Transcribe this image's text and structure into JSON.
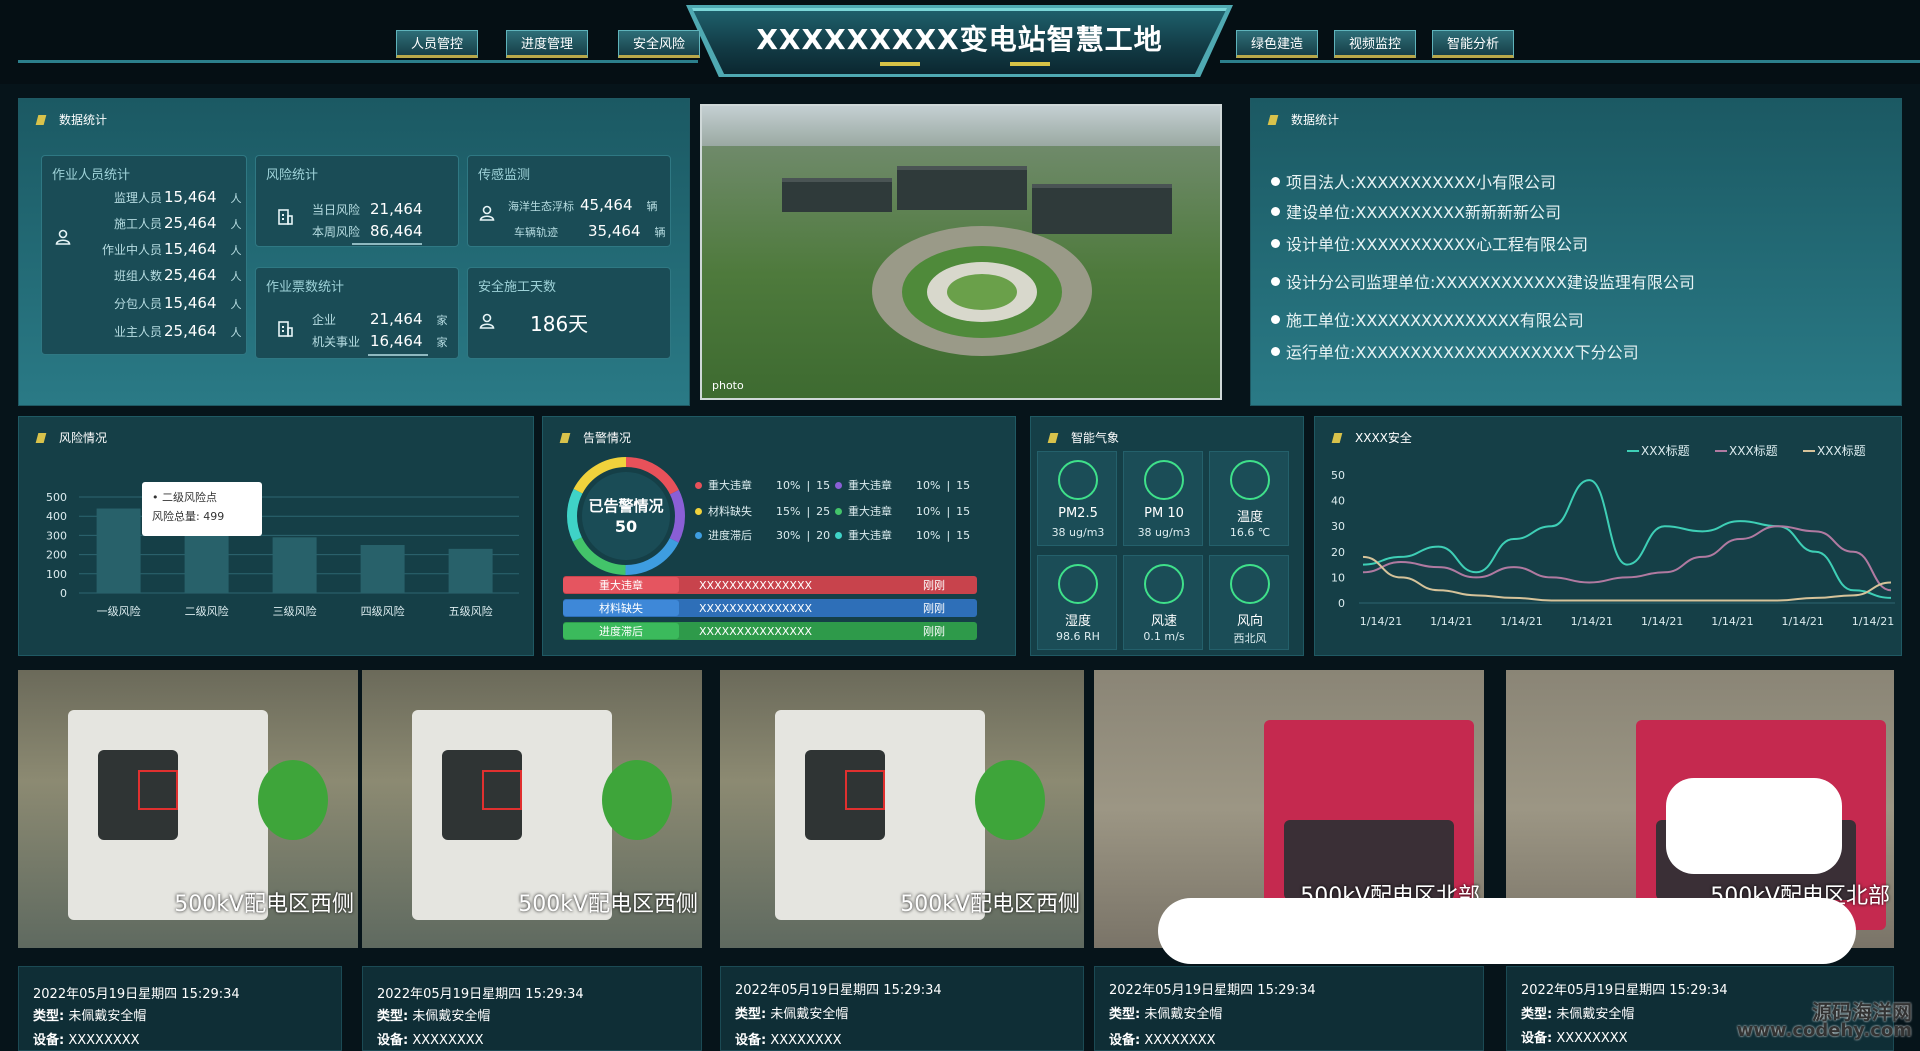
{
  "header": {
    "title": "XXXXXXXXX变电站智慧工地",
    "nav_left": [
      "人员管控",
      "进度管理",
      "安全风险"
    ],
    "nav_right": [
      "绿色建造",
      "视频监控",
      "智能分析"
    ]
  },
  "stats": {
    "title": "数据统计",
    "workers": {
      "title": "作业人员统计",
      "rows": [
        {
          "label": "监理人员",
          "value": "15,464",
          "unit": "人"
        },
        {
          "label": "施工人员",
          "value": "25,464",
          "unit": "人"
        },
        {
          "label": "作业中人员",
          "value": "15,464",
          "unit": "人"
        },
        {
          "label": "班组人数",
          "value": "25,464",
          "unit": "人"
        },
        {
          "label": "分包人员",
          "value": "15,464",
          "unit": "人"
        },
        {
          "label": "业主人员",
          "value": "25,464",
          "unit": "人"
        }
      ]
    },
    "risk": {
      "title": "风险统计",
      "rows": [
        {
          "label": "当日风险",
          "value": "21,464"
        },
        {
          "label": "本周风险",
          "value": "86,464"
        }
      ]
    },
    "sensor": {
      "title": "传感监测",
      "rows": [
        {
          "label": "海洋生态浮标",
          "value": "45,464",
          "unit": "辆"
        },
        {
          "label": "车辆轨迹",
          "value": "35,464",
          "unit": "辆"
        }
      ]
    },
    "tickets": {
      "title": "作业票数统计",
      "rows": [
        {
          "label": "企业",
          "value": "21,464",
          "unit": "家"
        },
        {
          "label": "机关事业",
          "value": "16,464",
          "unit": "家"
        }
      ]
    },
    "safe_days": {
      "title": "安全施工天数",
      "value": "186天"
    }
  },
  "site_image": {
    "watermark": "photo"
  },
  "info": {
    "title": "数据统计",
    "items": [
      "项目法人:XXXXXXXXXXX小有限公司",
      "建设单位:XXXXXXXXXX新新新新公司",
      "设计单位:XXXXXXXXXXX心工程有限公司",
      "设计分公司监理单位:XXXXXXXXXXXX建设监理有限公司",
      "施工单位:XXXXXXXXXXXXXXX有限公司",
      "运行单位:XXXXXXXXXXXXXXXXXXXX下分公司"
    ]
  },
  "risk_panel": {
    "title": "风险情况",
    "tooltip": {
      "name": "二级风险点",
      "label": "风险总量",
      "value": "499"
    }
  },
  "chart_data": [
    {
      "type": "bar",
      "categories": [
        "一级风险",
        "二级风险",
        "三级风险",
        "四级风险",
        "五级风险"
      ],
      "values": [
        440,
        499,
        290,
        250,
        230
      ],
      "ylim": [
        0,
        500
      ],
      "yticks": [
        "0",
        "100",
        "200",
        "300",
        "400",
        "500"
      ],
      "title": "",
      "xlabel": "",
      "ylabel": "",
      "grid": true
    },
    {
      "type": "line",
      "title": "",
      "x": [
        "1/14/21",
        "1/14/21",
        "1/14/21",
        "1/14/21",
        "1/14/21",
        "1/14/21",
        "1/14/21",
        "1/14/21"
      ],
      "ylim": [
        0,
        50
      ],
      "yticks": [
        "0",
        "10",
        "20",
        "30",
        "40",
        "50"
      ],
      "legend_placement": "top-right",
      "series": [
        {
          "name": "XXX标题",
          "color": "#3ecfb6",
          "values": [
            15,
            18,
            22,
            12,
            25,
            30,
            48,
            15,
            30,
            28,
            32,
            30,
            20,
            5,
            2
          ]
        },
        {
          "name": "XXX标题",
          "color": "#b07aa1",
          "values": [
            12,
            16,
            14,
            10,
            14,
            10,
            8,
            10,
            12,
            18,
            25,
            30,
            28,
            20,
            5
          ]
        },
        {
          "name": "XXX标题",
          "color": "#d6c39a",
          "values": [
            18,
            10,
            5,
            3,
            2,
            1,
            1,
            1,
            1,
            1,
            1,
            1,
            2,
            3,
            8
          ]
        }
      ]
    }
  ],
  "alarm": {
    "title": "告警情况",
    "donut_label": "已告警情况",
    "donut_value": "50",
    "legend": [
      {
        "name": "重大违章",
        "pct": "10%",
        "count": "15",
        "color": "#e8515a"
      },
      {
        "name": "材料缺失",
        "pct": "15%",
        "count": "25",
        "color": "#f0d23c"
      },
      {
        "name": "进度滞后",
        "pct": "30%",
        "count": "20",
        "color": "#3e9de0"
      },
      {
        "name": "重大违章",
        "pct": "10%",
        "count": "15",
        "color": "#8a5fd6"
      },
      {
        "name": "重大违章",
        "pct": "10%",
        "count": "15",
        "color": "#43c46a"
      },
      {
        "name": "重大违章",
        "pct": "10%",
        "count": "15",
        "color": "#3fd3c7"
      }
    ],
    "bars": [
      {
        "label": "重大违章",
        "content": "XXXXXXXXXXXXXXX",
        "time": "刚刚",
        "color": "#c8434c",
        "tag": "#e55560"
      },
      {
        "label": "材料缺失",
        "content": "XXXXXXXXXXXXXXX",
        "time": "刚刚",
        "color": "#2e6fb8",
        "tag": "#3e88d8"
      },
      {
        "label": "进度滞后",
        "content": "XXXXXXXXXXXXXXX",
        "time": "刚刚",
        "color": "#2e9a4a",
        "tag": "#3bba5c"
      }
    ]
  },
  "weather": {
    "title": "智能气象",
    "items": [
      {
        "name": "PM2.5",
        "value": "38 ug/m3"
      },
      {
        "name": "PM 10",
        "value": "38 ug/m3"
      },
      {
        "name": "温度",
        "value": "16.6 ℃"
      },
      {
        "name": "湿度",
        "value": "98.6 RH"
      },
      {
        "name": "风速",
        "value": "0.1 m/s"
      },
      {
        "name": "风向",
        "value": "西北风"
      }
    ]
  },
  "line_panel": {
    "title": "XXXX安全"
  },
  "cameras": [
    {
      "caption": "500kV配电区西侧",
      "time": "2022年05月19日星期四 15:29:34",
      "type_label": "类型:",
      "type": "未佩戴安全帽",
      "device_label": "设备:",
      "device": "XXXXXXXX"
    },
    {
      "caption": "500kV配电区西侧",
      "time": "2022年05月19日星期四 15:29:34",
      "type_label": "类型:",
      "type": "未佩戴安全帽",
      "device_label": "设备:",
      "device": "XXXXXXXX"
    },
    {
      "caption": "500kV配电区西侧",
      "time": "2022年05月19日星期四 15:29:34",
      "type_label": "类型:",
      "type": "未佩戴安全帽",
      "device_label": "设备:",
      "device": "XXXXXXXX"
    },
    {
      "caption": "500kV配电区北部",
      "time": "2022年05月19日星期四 15:29:34",
      "type_label": "类型:",
      "type": "未佩戴安全帽",
      "device_label": "设备:",
      "device": "XXXXXXXX"
    },
    {
      "caption": "500kV配电区北部",
      "time": "2022年05月19日星期四 15:29:34",
      "type_label": "类型:",
      "type": "未佩戴安全帽",
      "device_label": "设备:",
      "device": "XXXXXXXX"
    }
  ],
  "corner_watermark": {
    "line1": "源码海洋网",
    "line2": "www.codehy.com"
  }
}
